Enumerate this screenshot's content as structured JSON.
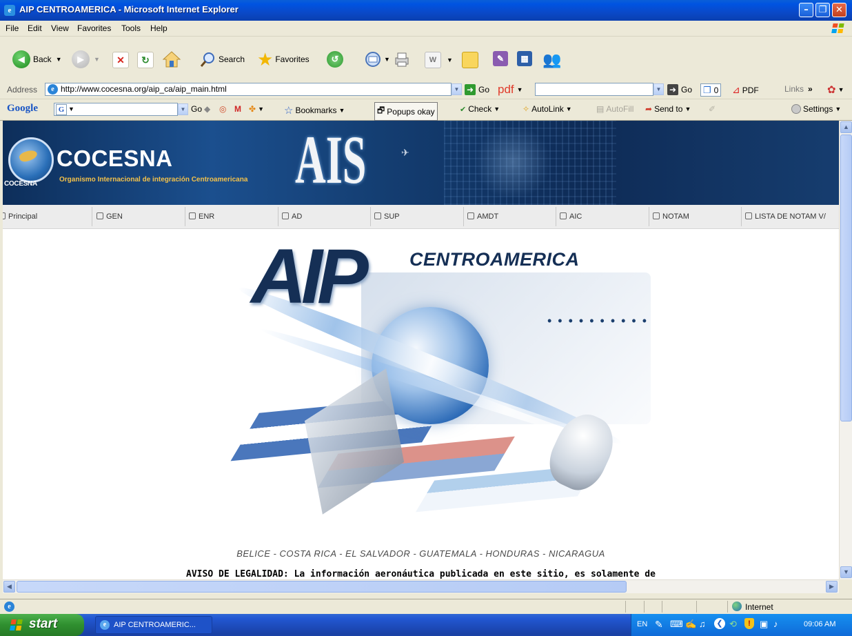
{
  "window": {
    "title": "AIP CENTROAMERICA - Microsoft Internet Explorer",
    "title_icon": "e",
    "controls": [
      "minimize",
      "maximize",
      "close"
    ]
  },
  "menu": {
    "items": [
      "File",
      "Edit",
      "View",
      "Favorites",
      "Tools",
      "Help"
    ]
  },
  "toolbar": {
    "back_label": "Back",
    "search_label": "Search",
    "favorites_label": "Favorites"
  },
  "address": {
    "label": "Address",
    "url": "http://www.cocesna.org/aip_ca/aip_main.html",
    "go_label": "Go",
    "pdf_label": "pdf",
    "go2_label": "Go",
    "counter": "0",
    "pdf_button_label": "PDF",
    "links_label": "Links"
  },
  "googlebar": {
    "logo": "Google",
    "go_label": "Go",
    "bookmarks_label": "Bookmarks",
    "popups_label": "Popups okay",
    "check_label": "Check",
    "autolink_label": "AutoLink",
    "autofill_label": "AutoFill",
    "sendto_label": "Send to",
    "settings_label": "Settings"
  },
  "banner": {
    "org_name": "COCESNA",
    "org_subtitle": "Organismo Internacional de integración Centroamericana",
    "logo_text": "COCESNA",
    "ais_text": "AIS"
  },
  "nav": {
    "items": [
      "Principal",
      "GEN",
      "ENR",
      "AD",
      "SUP",
      "AMDT",
      "AIC",
      "NOTAM",
      "LISTA DE NOTAM V/"
    ]
  },
  "main": {
    "aip_text": "AIP",
    "centroamerica_text": "CENTROAMERICA",
    "countries": "BELICE - COSTA RICA - EL SALVADOR - GUATEMALA - HONDURAS - NICARAGUA",
    "notice": "AVISO DE LEGALIDAD: La información aeronáutica publicada en este sitio, es solamente de"
  },
  "status": {
    "zone_label": "Internet"
  },
  "taskbar": {
    "start_label": "start",
    "task_item_label": "AIP CENTROAMERIC...",
    "lang": "EN",
    "clock": "09:06 AM"
  },
  "colors": {
    "titlebar": "#0a49c8",
    "banner": "#143e72",
    "start_green": "#2f8f2f",
    "taskbar_blue": "#2257d2"
  }
}
